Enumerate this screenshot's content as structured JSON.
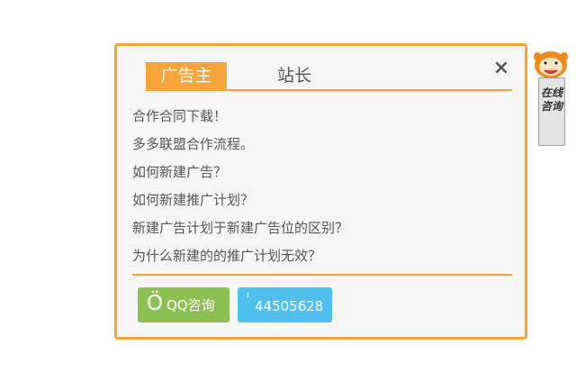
{
  "tabs": [
    {
      "label": "广告主",
      "active": true
    },
    {
      "label": "站长",
      "active": false
    }
  ],
  "close_label": "×",
  "faq_items": [
    "合作合同下载！",
    "多多联盟合作流程。",
    "如何新建广告？",
    "如何新建推广计划？",
    "新建广告计划于新建广告位的区别？",
    "为什么新建的的推广计划无效？"
  ],
  "contact": {
    "qq": {
      "icon_glyph": "Ö",
      "label": "QQ咨询"
    },
    "phone": {
      "icon_glyph": "'",
      "label": "44505628"
    }
  },
  "side_widget": {
    "label": "在线咨询",
    "icon": "mascot-icon"
  },
  "colors": {
    "accent": "#f5a33b",
    "qq_button": "#8cc152",
    "phone_button": "#4fc0f0",
    "panel_bg": "#f6f6f6",
    "text": "#555555"
  }
}
